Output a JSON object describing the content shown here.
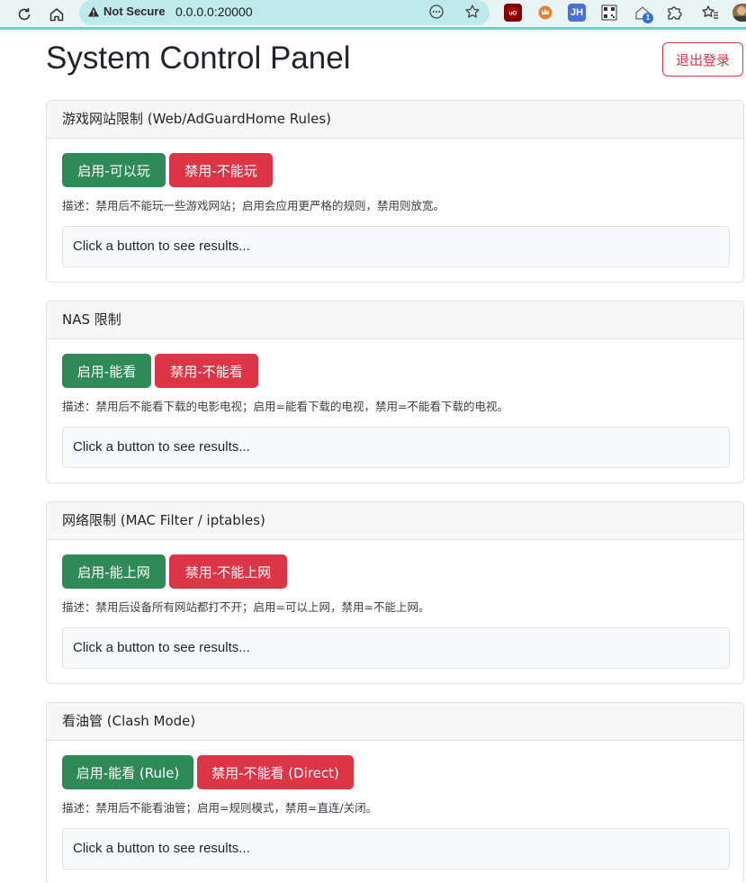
{
  "browser": {
    "not_secure": "Not Secure",
    "url": "0.0.0.0:20000",
    "extensions": [
      "ublock-icon",
      "fox-extension-icon",
      "JH",
      "qr-code-icon",
      "home-extension-icon",
      "puzzle-icon"
    ],
    "ext_jh_label": "JH",
    "home_badge": "1"
  },
  "page": {
    "title": "System Control Panel",
    "logout_label": "退出登录"
  },
  "cards": [
    {
      "header": "游戏网站限制 (Web/AdGuardHome Rules)",
      "enable_label": "启用-可以玩",
      "disable_label": "禁用-不能玩",
      "description": "描述：禁用后不能玩一些游戏网站；启用会应用更严格的规则，禁用则放宽。",
      "result": "Click a button to see results..."
    },
    {
      "header": "NAS 限制",
      "enable_label": "启用-能看",
      "disable_label": "禁用-不能看",
      "description": "描述：禁用后不能看下载的电影电视；启用=能看下载的电视，禁用=不能看下载的电视。",
      "result": "Click a button to see results..."
    },
    {
      "header": "网络限制 (MAC Filter / iptables)",
      "enable_label": "启用-能上网",
      "disable_label": "禁用-不能上网",
      "description": "描述：禁用后设备所有网站都打不开；启用=可以上网，禁用=不能上网。",
      "result": "Click a button to see results..."
    },
    {
      "header": "看油管 (Clash Mode)",
      "enable_label": "启用-能看 (Rule)",
      "disable_label": "禁用-不能看 (Direct)",
      "description": "描述：禁用后不能看油管；启用=规则模式，禁用=直连/关闭。",
      "result": "Click a button to see results..."
    }
  ],
  "colors": {
    "enable": "#2e8b57",
    "disable": "#dc3545",
    "toolbar_accent": "#6ecfd0"
  }
}
